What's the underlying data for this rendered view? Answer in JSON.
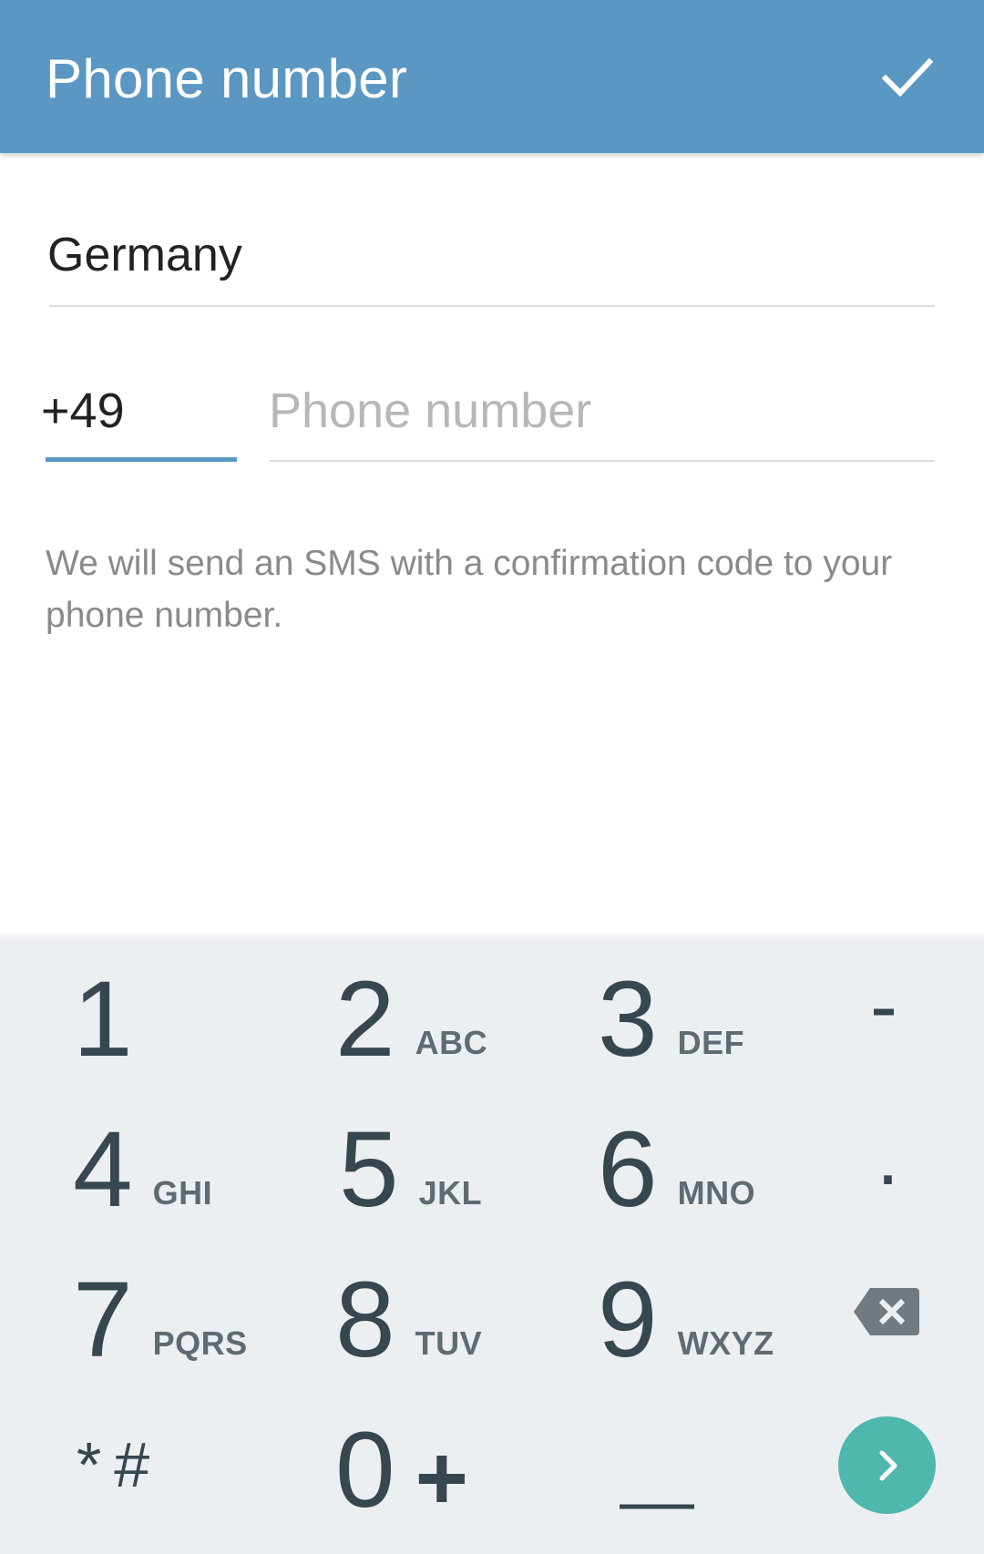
{
  "appbar": {
    "title": "Phone number",
    "confirm_icon": "check-icon"
  },
  "form": {
    "country": "Germany",
    "country_code": "+49",
    "phone_placeholder": "Phone number",
    "info_text": "We will send an SMS with a confirmation code to your phone number."
  },
  "keypad": {
    "keys": [
      {
        "num": "1",
        "letters": ""
      },
      {
        "num": "2",
        "letters": "ABC"
      },
      {
        "num": "3",
        "letters": "DEF"
      },
      {
        "num": "4",
        "letters": "GHI"
      },
      {
        "num": "5",
        "letters": "JKL"
      },
      {
        "num": "6",
        "letters": "MNO"
      },
      {
        "num": "7",
        "letters": "PQRS"
      },
      {
        "num": "8",
        "letters": "TUV"
      },
      {
        "num": "9",
        "letters": "WXYZ"
      },
      {
        "num": "0",
        "letters": "+"
      }
    ],
    "dash": "-",
    "dot": ".",
    "star": "*",
    "hash": "#",
    "backspace_icon": "backspace-icon",
    "space_icon": "space-bar-icon",
    "next_icon": "chevron-right-icon"
  },
  "colors": {
    "appbar": "#5b97c3",
    "accent_line": "#5b97c3",
    "next_button": "#4fb7ad",
    "keypad_bg": "#eceff1"
  }
}
